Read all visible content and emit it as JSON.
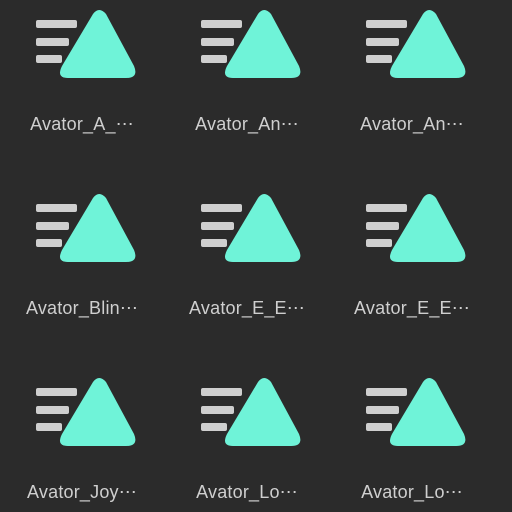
{
  "colors": {
    "background": "#2b2b2b",
    "accent": "#6ff3d8",
    "speed_lines": "#cfcfcf",
    "label_text": "#cfcfcf"
  },
  "icon": "animation-clip-icon",
  "files": [
    {
      "label": "Avator_A_⋯"
    },
    {
      "label": "Avator_An⋯"
    },
    {
      "label": "Avator_An⋯"
    },
    {
      "label": "Avator_Blin⋯"
    },
    {
      "label": "Avator_E_E⋯"
    },
    {
      "label": "Avator_E_E⋯"
    },
    {
      "label": "Avator_Joy⋯"
    },
    {
      "label": "Avator_Lo⋯"
    },
    {
      "label": "Avator_Lo⋯"
    }
  ]
}
